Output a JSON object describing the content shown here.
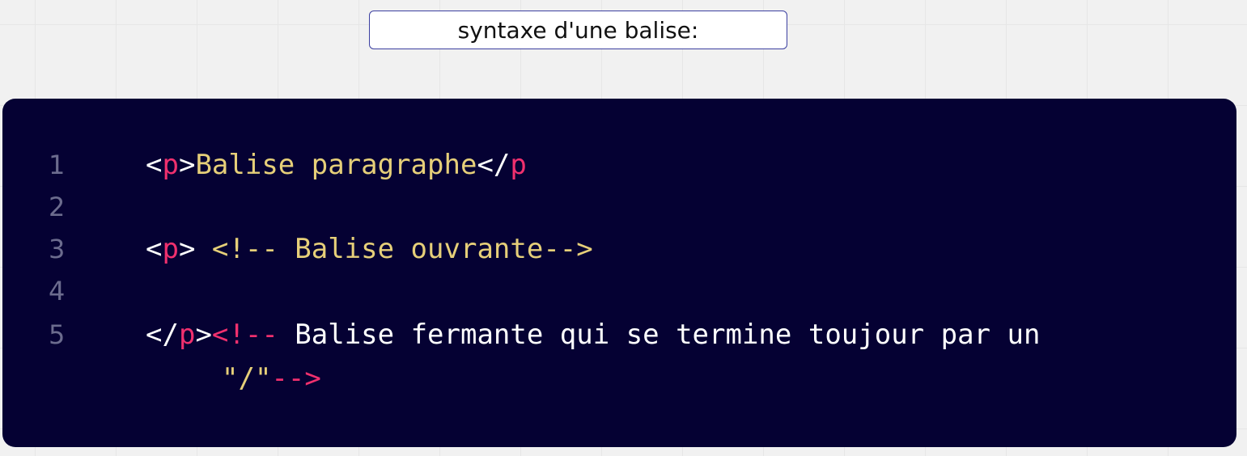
{
  "title": "syntaxe d'une balise:",
  "line_numbers": [
    "1",
    "2",
    "3",
    "4",
    "5"
  ],
  "colors": {
    "background": "#f1f1f1",
    "panel": "#050133",
    "tag_bracket": "#ffffff",
    "tag_name": "#f0306e",
    "string_text": "#e6cf79",
    "line_number": "#6c6c8e"
  },
  "code": {
    "line1": {
      "open_lt": "<",
      "open_name": "p",
      "open_gt": ">",
      "content": "Balise paragraphe",
      "close_lt": "</",
      "close_name": "p"
    },
    "line3": {
      "lt": "<",
      "name": "p",
      "gt": "> ",
      "comment": "<!-- Balise ouvrante-->"
    },
    "line5": {
      "lt": "</",
      "name": "p",
      "gt": ">",
      "comment_open": "<!--",
      "comment_text": " Balise fermante qui se termine toujour par un",
      "cont_text": "\"/\"",
      "comment_close": "-->"
    }
  }
}
